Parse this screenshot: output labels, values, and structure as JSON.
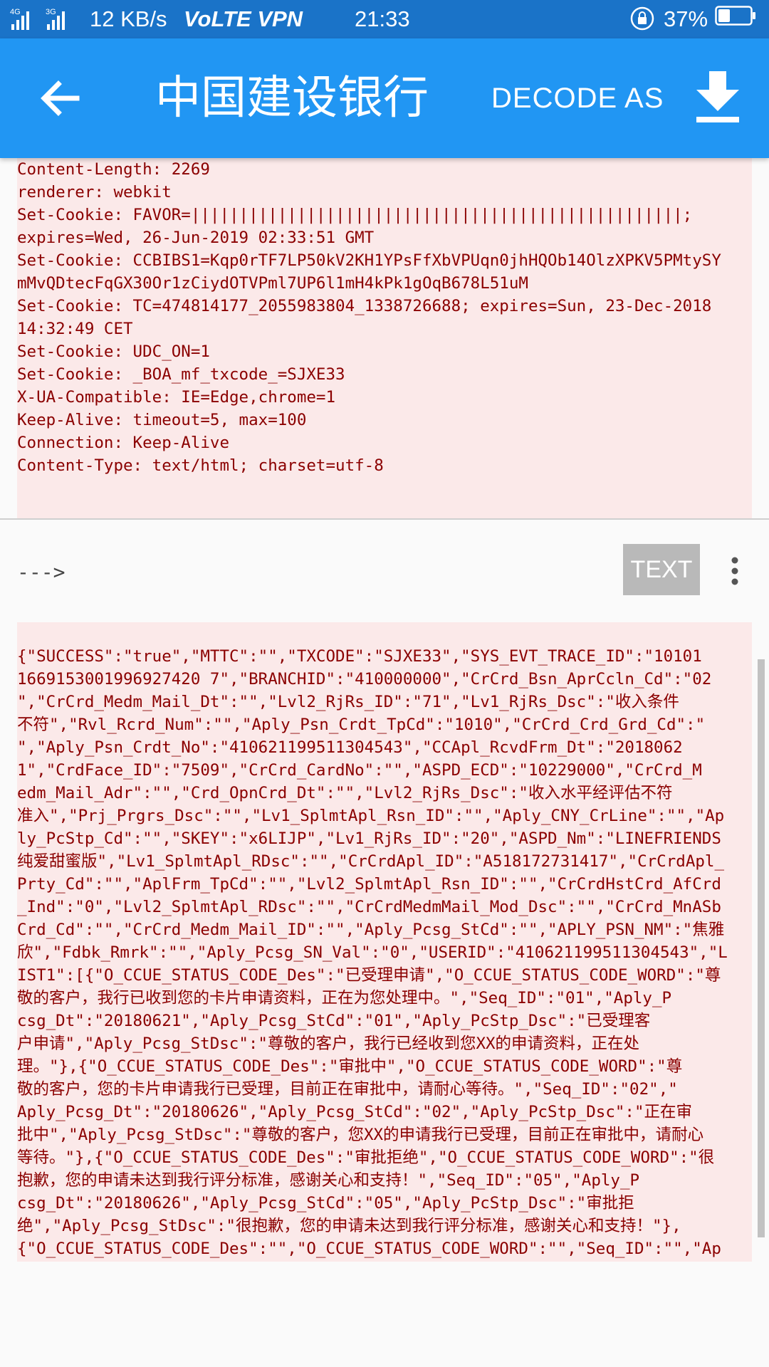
{
  "status_bar": {
    "network_label": "4G 3G",
    "speed": "12 KB/s",
    "volte_vpn": "VoLTE VPN",
    "time": "21:33",
    "battery_percent": "37%",
    "battery_level": 0.37
  },
  "app_bar": {
    "title": "中国建设银行",
    "decode_as_label": "DECODE AS",
    "back_icon": "arrow-back-icon",
    "download_icon": "download-icon"
  },
  "response_headers": [
    "Content-Length: 2269",
    "renderer: webkit",
    "Set-Cookie: FAVOR=|||||||||||||||||||||||||||||||||||||||||||||||||||;",
    "expires=Wed, 26-Jun-2019 02:33:51 GMT",
    "Set-Cookie: CCBIBS1=Kqp0rTF7LP50kV2KH1YPsFfXbVPUqn0jhHQOb14OlzXPKV5PMtySY",
    "mMvQDtecFqGX30Or1zCiydOTVPml7UP6l1mH4kPk1gOqB678L51uM",
    "Set-Cookie: TC=474814177_2055983804_1338726688; expires=Sun, 23-Dec-2018",
    "14:32:49 CET",
    "Set-Cookie: UDC_ON=1",
    "Set-Cookie: _BOA_mf_txcode_=SJXE33",
    "X-UA-Compatible: IE=Edge,chrome=1",
    "Keep-Alive: timeout=5, max=100",
    "Connection: Keep-Alive",
    "Content-Type: text/html; charset=utf-8"
  ],
  "toolbar": {
    "arrow_label": "--->",
    "text_button_label": "TEXT",
    "more_icon": "more-vert-icon"
  },
  "body_lines": [
    "{\"SUCCESS\":\"true\",\"MTTC\":\"\",\"TXCODE\":\"SJXE33\",\"SYS_EVT_TRACE_ID\":\"10101",
    "1669153001996927420 7\",\"BRANCHID\":\"410000000\",\"CrCrd_Bsn_AprCcln_Cd\":\"02",
    "\",\"CrCrd_Medm_Mail_Dt\":\"\",\"Lvl2_RjRs_ID\":\"71\",\"Lv1_RjRs_Dsc\":\"收入条件",
    "不符\",\"Rvl_Rcrd_Num\":\"\",\"Aply_Psn_Crdt_TpCd\":\"1010\",\"CrCrd_Crd_Grd_Cd\":\"",
    "\",\"Aply_Psn_Crdt_No\":\"410621199511304543\",\"CCApl_RcvdFrm_Dt\":\"2018062",
    "1\",\"CrdFace_ID\":\"7509\",\"CrCrd_CardNo\":\"\",\"ASPD_ECD\":\"10229000\",\"CrCrd_M",
    "edm_Mail_Adr\":\"\",\"Crd_OpnCrd_Dt\":\"\",\"Lvl2_RjRs_Dsc\":\"收入水平经评估不符",
    "准入\",\"Prj_Prgrs_Dsc\":\"\",\"Lv1_SplmtApl_Rsn_ID\":\"\",\"Aply_CNY_CrLine\":\"\",\"Ap",
    "ly_PcStp_Cd\":\"\",\"SKEY\":\"x6LIJP\",\"Lv1_RjRs_ID\":\"20\",\"ASPD_Nm\":\"LINEFRIENDS",
    "纯爱甜蜜版\",\"Lv1_SplmtApl_RDsc\":\"\",\"CrCrdApl_ID\":\"A518172731417\",\"CrCrdApl_",
    "Prty_Cd\":\"\",\"AplFrm_TpCd\":\"\",\"Lvl2_SplmtApl_Rsn_ID\":\"\",\"CrCrdHstCrd_AfCrd",
    "_Ind\":\"0\",\"Lvl2_SplmtApl_RDsc\":\"\",\"CrCrdMedmMail_Mod_Dsc\":\"\",\"CrCrd_MnASb",
    "Crd_Cd\":\"\",\"CrCrd_Medm_Mail_ID\":\"\",\"Aply_Pcsg_StCd\":\"\",\"APLY_PSN_NM\":\"焦雅",
    "欣\",\"Fdbk_Rmrk\":\"\",\"Aply_Pcsg_SN_Val\":\"0\",\"USERID\":\"410621199511304543\",\"L",
    "IST1\":[{\"O_CCUE_STATUS_CODE_Des\":\"已受理申请\",\"O_CCUE_STATUS_CODE_WORD\":\"尊",
    "敬的客户，我行已收到您的卡片申请资料，正在为您处理中。\",\"Seq_ID\":\"01\",\"Aply_P",
    "csg_Dt\":\"20180621\",\"Aply_Pcsg_StCd\":\"01\",\"Aply_PcStp_Dsc\":\"已受理客",
    "户申请\",\"Aply_Pcsg_StDsc\":\"尊敬的客户，我行已经收到您XX的申请资料，正在处",
    "理。\"},{\"O_CCUE_STATUS_CODE_Des\":\"审批中\",\"O_CCUE_STATUS_CODE_WORD\":\"尊",
    "敬的客户，您的卡片申请我行已受理，目前正在审批中，请耐心等待。\",\"Seq_ID\":\"02\",\"",
    "Aply_Pcsg_Dt\":\"20180626\",\"Aply_Pcsg_StCd\":\"02\",\"Aply_PcStp_Dsc\":\"正在审",
    "批中\",\"Aply_Pcsg_StDsc\":\"尊敬的客户，您XX的申请我行已受理，目前正在审批中，请耐心",
    "等待。\"},{\"O_CCUE_STATUS_CODE_Des\":\"审批拒绝\",\"O_CCUE_STATUS_CODE_WORD\":\"很",
    "抱歉，您的申请未达到我行评分标准，感谢关心和支持！\",\"Seq_ID\":\"05\",\"Aply_P",
    "csg_Dt\":\"20180626\",\"Aply_Pcsg_StCd\":\"05\",\"Aply_PcStp_Dsc\":\"审批拒",
    "绝\",\"Aply_Pcsg_StDsc\":\"很抱歉，您的申请未达到我行评分标准，感谢关心和支持！\"},",
    "{\"O_CCUE_STATUS_CODE_Des\":\"\",\"O_CCUE_STATUS_CODE_WORD\":\"\",\"Seq_ID\":\"\",\"Ap"
  ]
}
